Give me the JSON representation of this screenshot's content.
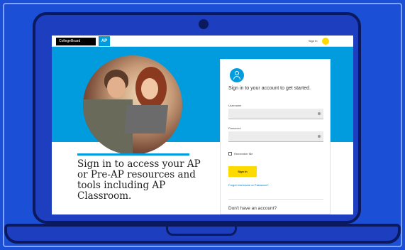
{
  "brand": {
    "logo_text": "CollegeBoard",
    "ap_tag": "AP"
  },
  "topbar": {
    "signin_link": "Sign In"
  },
  "hero": {
    "headline": "Sign in to access your AP or Pre-AP resources and tools including AP Classroom."
  },
  "login": {
    "title": "Sign in to your account to get started.",
    "username_label": "Username",
    "password_label": "Password",
    "remember_label": "Remember Me",
    "submit_label": "Sign In",
    "forgot_link": "Forgot Username or Password?",
    "no_account": "Don't have an account?"
  },
  "colors": {
    "background": "#1a4fd6",
    "ap_blue": "#009cde",
    "accent_yellow": "#fedb00"
  }
}
